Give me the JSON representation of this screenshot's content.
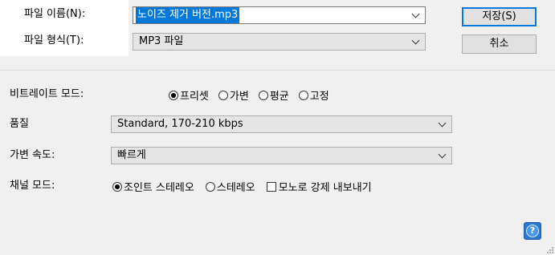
{
  "file": {
    "name_label": "파일 이름(N):",
    "name_value": "노이즈 제거 버전.mp3",
    "type_label": "파일 형식(T):",
    "type_value": "MP3 파일"
  },
  "buttons": {
    "save": "저장(S)",
    "cancel": "취소"
  },
  "bitrate": {
    "label": "비트레이트 모드:",
    "options": [
      "프리셋",
      "가변",
      "평균",
      "고정"
    ],
    "selected": "프리셋"
  },
  "quality": {
    "label": "품질",
    "value": "Standard, 170-210 kbps"
  },
  "vbr_speed": {
    "label": "가변 속도:",
    "value": "빠르게"
  },
  "channel": {
    "label": "채널 모드:",
    "options": [
      "조인트 스테레오",
      "스테레오"
    ],
    "selected": "조인트 스테레오",
    "mono_checkbox": "모노로 강제 내보내기",
    "mono_checked": false
  },
  "help": {
    "glyph": "?"
  }
}
